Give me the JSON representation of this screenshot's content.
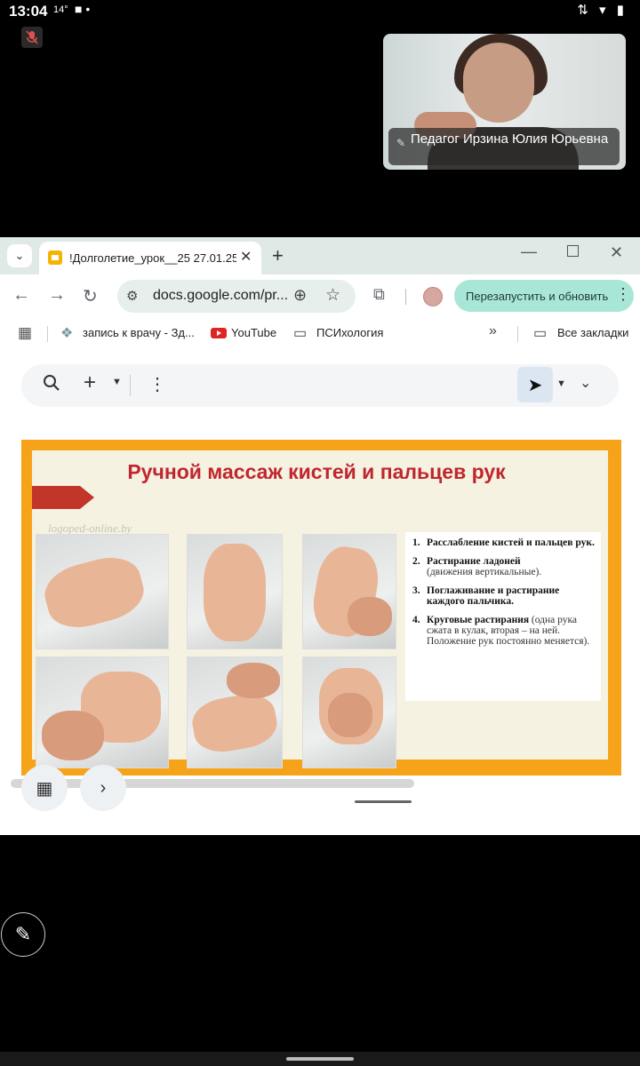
{
  "status_bar": {
    "time": "13:04",
    "temp": "14°"
  },
  "video": {
    "name": "Педагог Ирзина Юлия Юрьевна"
  },
  "browser": {
    "tab_title": "!Долголетие_урок__25 27.01.25",
    "url": "docs.google.com/pr...",
    "relaunch_label": "Перезапустить и обновить",
    "bookmarks": [
      {
        "label": "запись к врачу - Зд..."
      },
      {
        "label": "YouTube"
      },
      {
        "label": "ПСИхология"
      }
    ],
    "all_bookmarks_label": "Все закладки"
  },
  "slide": {
    "title": "Ручной массаж кистей и пальцев рук",
    "watermark": "logoped-online.by",
    "items": [
      {
        "num": "1.",
        "bold": "Расслабление кистей и пальцев рук.",
        "rest": ""
      },
      {
        "num": "2.",
        "bold": "Растирание ладоней",
        "rest": "(движения вертикальные)."
      },
      {
        "num": "3.",
        "bold": "Поглаживание и растирание каждого пальчика.",
        "rest": ""
      },
      {
        "num": "4.",
        "bold": "Круговые растирания",
        "rest": "(одна рука сжата в кулак, вторая – на ней. Положение рук постоянно меняется)."
      }
    ]
  },
  "colors": {
    "slide_border": "#f6a319",
    "title_red": "#c0262d",
    "relaunch_bg": "#a8e6d8",
    "tabstrip_bg": "#dfe9e6"
  }
}
